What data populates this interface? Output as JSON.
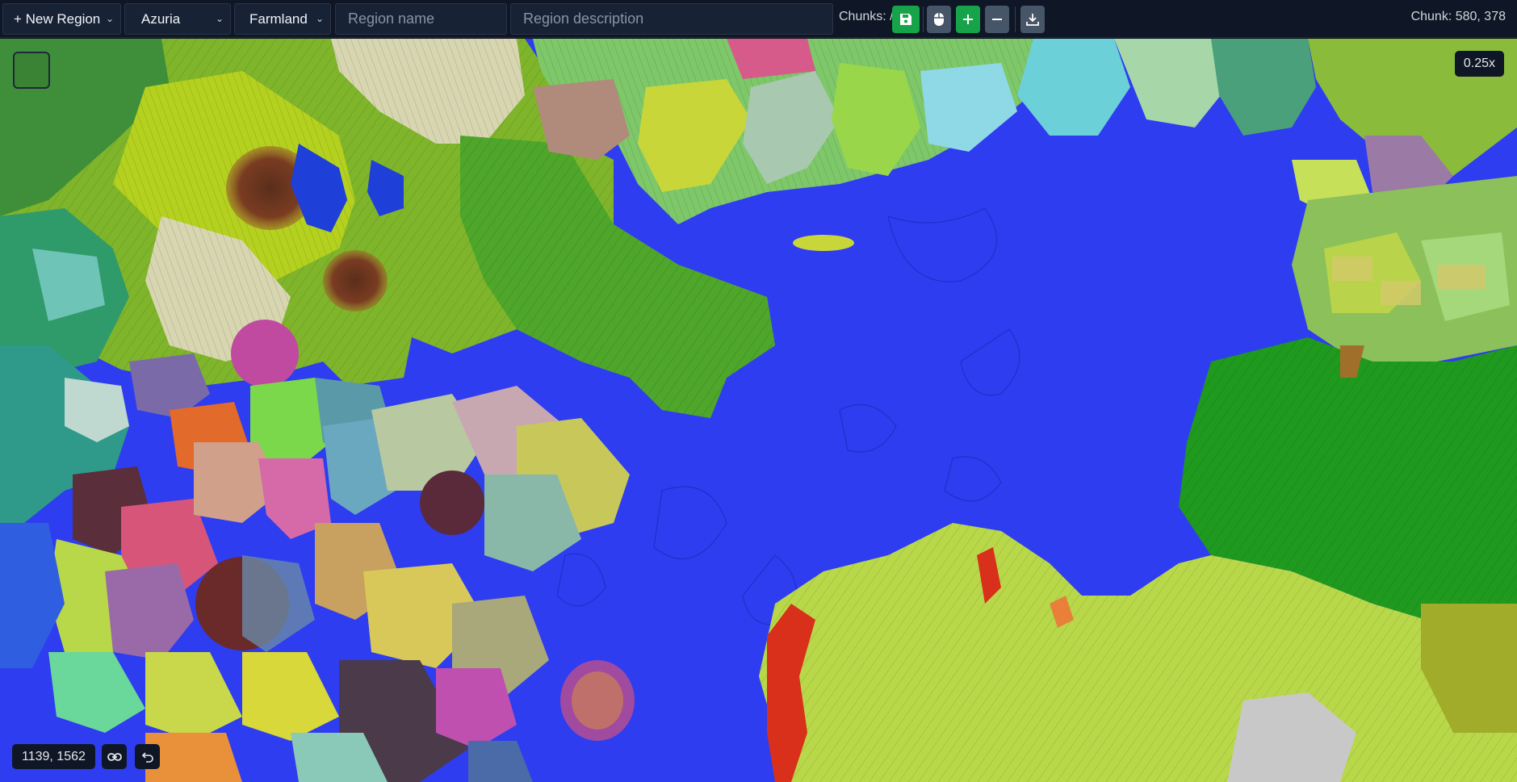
{
  "toolbar": {
    "new_region_label": "+ New Region",
    "world_select": "Azuria",
    "type_select": "Farmland",
    "region_name_placeholder": "Region name",
    "region_description_placeholder": "Region description",
    "chunks_label": "Chunks: /",
    "chunk_readout": "Chunk: 580, 378"
  },
  "map": {
    "zoom_label": "0.25x",
    "coordinates": "1139, 1562"
  },
  "colors": {
    "toolbar_bg": "#0f1726",
    "accent_green": "#16a34a",
    "button_gray": "#475569",
    "ocean": "#2e3df0"
  },
  "icons": [
    "save-icon",
    "mouse-icon",
    "plus-icon",
    "minus-icon",
    "download-icon",
    "link-icon",
    "undo-icon",
    "chevron-down-icon"
  ]
}
